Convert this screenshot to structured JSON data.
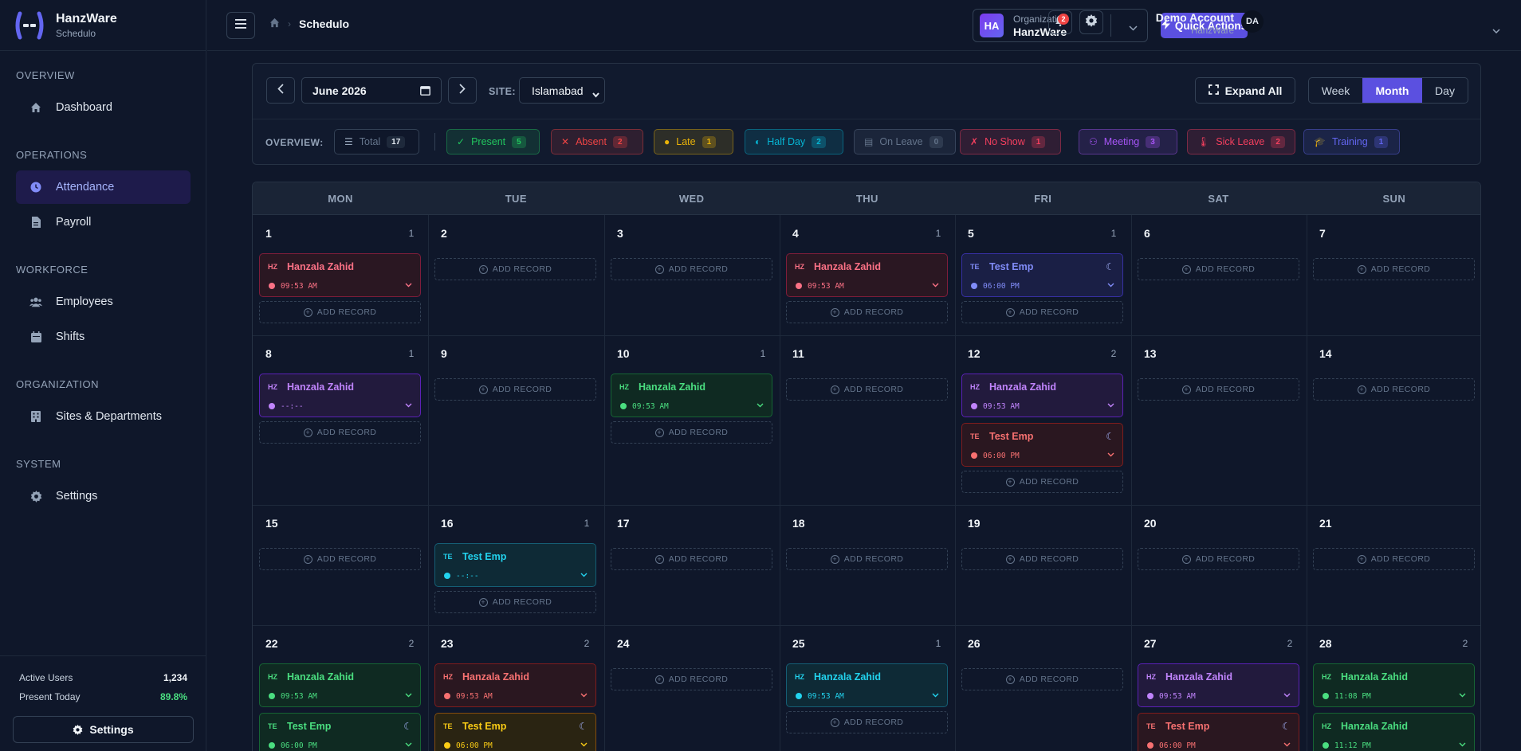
{
  "brand": {
    "name": "HanzWare",
    "sub": "Schedulo"
  },
  "nav": {
    "overview": "OVERVIEW",
    "dashboard": "Dashboard",
    "operations": "OPERATIONS",
    "attendance": "Attendance",
    "payroll": "Payroll",
    "workforce": "WORKFORCE",
    "employees": "Employees",
    "shifts": "Shifts",
    "organization": "ORGANIZATION",
    "sites": "Sites & Departments",
    "system": "SYSTEM",
    "settings": "Settings"
  },
  "sidebar_footer": {
    "active_users_label": "Active Users",
    "active_users_value": "1,234",
    "present_today_label": "Present Today",
    "present_today_value": "89.8%",
    "settings_button": "Settings"
  },
  "topbar": {
    "breadcrumb_current": "Schedulo",
    "org_badge": "HA",
    "org_label": "Organization",
    "org_name": "HanzWare",
    "quick_actions": "Quick Actions",
    "notif_count": "2",
    "account_name": "Demo Account",
    "account_sub": "HanzWare",
    "avatar": "DA"
  },
  "toolbar": {
    "date": "June 2026",
    "site_label": "SITE:",
    "site_value": "Islamabad",
    "expand_all": "Expand All",
    "views": [
      "Week",
      "Month",
      "Day"
    ],
    "active_view": "Month"
  },
  "overview": {
    "label": "OVERVIEW:",
    "chips": [
      {
        "label": "Total",
        "count": "17",
        "color": "#94a3b8"
      },
      {
        "label": "Present",
        "count": "5",
        "color": "#22c55e"
      },
      {
        "label": "Absent",
        "count": "2",
        "color": "#ef4444"
      },
      {
        "label": "Late",
        "count": "1",
        "color": "#eab308"
      },
      {
        "label": "Half Day",
        "count": "2",
        "color": "#06b6d4"
      },
      {
        "label": "On Leave",
        "count": "0",
        "color": "#64748b"
      },
      {
        "label": "No Show",
        "count": "1",
        "color": "#f43f5e"
      },
      {
        "label": "Meeting",
        "count": "3",
        "color": "#a855f7"
      },
      {
        "label": "Sick Leave",
        "count": "2",
        "color": "#f43f5e"
      },
      {
        "label": "Training",
        "count": "1",
        "color": "#6366f1"
      }
    ]
  },
  "calendar": {
    "days": [
      "MON",
      "TUE",
      "WED",
      "THU",
      "FRI",
      "SAT",
      "SUN"
    ],
    "add_label": "ADD RECORD",
    "weeks": [
      [
        {
          "d": "1",
          "count": "1",
          "records": [
            {
              "ini": "HZ",
              "name": "Hanzala Zahid",
              "time": "09:53 AM",
              "status": "sick"
            }
          ]
        },
        {
          "d": "2",
          "records": []
        },
        {
          "d": "3",
          "records": []
        },
        {
          "d": "4",
          "count": "1",
          "records": [
            {
              "ini": "HZ",
              "name": "Hanzala Zahid",
              "time": "09:53 AM",
              "status": "sick"
            }
          ]
        },
        {
          "d": "5",
          "count": "1",
          "records": [
            {
              "ini": "TE",
              "name": "Test Emp",
              "time": "06:00 PM",
              "status": "training",
              "night": true
            }
          ]
        },
        {
          "d": "6",
          "records": []
        },
        {
          "d": "7",
          "records": []
        }
      ],
      [
        {
          "d": "8",
          "count": "1",
          "records": [
            {
              "ini": "HZ",
              "name": "Hanzala Zahid",
              "time": "--:--",
              "status": "meeting"
            }
          ]
        },
        {
          "d": "9",
          "records": []
        },
        {
          "d": "10",
          "count": "1",
          "records": [
            {
              "ini": "HZ",
              "name": "Hanzala Zahid",
              "time": "09:53 AM",
              "status": "present"
            }
          ]
        },
        {
          "d": "11",
          "records": []
        },
        {
          "d": "12",
          "count": "2",
          "records": [
            {
              "ini": "HZ",
              "name": "Hanzala Zahid",
              "time": "09:53 AM",
              "status": "meeting"
            },
            {
              "ini": "TE",
              "name": "Test Emp",
              "time": "06:00 PM",
              "status": "absent",
              "night": true
            }
          ]
        },
        {
          "d": "13",
          "records": []
        },
        {
          "d": "14",
          "records": []
        }
      ],
      [
        {
          "d": "15",
          "records": []
        },
        {
          "d": "16",
          "count": "1",
          "records": [
            {
              "ini": "TE",
              "name": "Test Emp",
              "time": "--:--",
              "status": "halfday"
            }
          ]
        },
        {
          "d": "17",
          "records": []
        },
        {
          "d": "18",
          "records": []
        },
        {
          "d": "19",
          "records": []
        },
        {
          "d": "20",
          "records": []
        },
        {
          "d": "21",
          "records": []
        }
      ],
      [
        {
          "d": "22",
          "count": "2",
          "records": [
            {
              "ini": "HZ",
              "name": "Hanzala Zahid",
              "time": "09:53 AM",
              "status": "present"
            },
            {
              "ini": "TE",
              "name": "Test Emp",
              "time": "06:00 PM",
              "status": "present",
              "night": true
            }
          ]
        },
        {
          "d": "23",
          "count": "2",
          "records": [
            {
              "ini": "HZ",
              "name": "Hanzala Zahid",
              "time": "09:53 AM",
              "status": "absent"
            },
            {
              "ini": "TE",
              "name": "Test Emp",
              "time": "06:00 PM",
              "status": "late",
              "night": true
            }
          ]
        },
        {
          "d": "24",
          "records": []
        },
        {
          "d": "25",
          "count": "1",
          "records": [
            {
              "ini": "HZ",
              "name": "Hanzala Zahid",
              "time": "09:53 AM",
              "status": "halfday"
            }
          ]
        },
        {
          "d": "26",
          "records": []
        },
        {
          "d": "27",
          "count": "2",
          "records": [
            {
              "ini": "HZ",
              "name": "Hanzala Zahid",
              "time": "09:53 AM",
              "status": "meeting"
            },
            {
              "ini": "TE",
              "name": "Test Emp",
              "time": "06:00 PM",
              "status": "absent",
              "night": true
            }
          ]
        },
        {
          "d": "28",
          "count": "2",
          "records": [
            {
              "ini": "HZ",
              "name": "Hanzala Zahid",
              "time": "11:08 PM",
              "status": "present"
            },
            {
              "ini": "HZ",
              "name": "Hanzala Zahid",
              "time": "11:12 PM",
              "status": "present"
            }
          ]
        }
      ]
    ]
  },
  "status_colors": {
    "present": {
      "bg": "#0f2a22",
      "border": "#166534",
      "text": "#4ade80"
    },
    "absent": {
      "bg": "#2a1720",
      "border": "#7f1d1d",
      "text": "#f87171"
    },
    "sick": {
      "bg": "#2a1722",
      "border": "#7f1d3a",
      "text": "#fb7185"
    },
    "meeting": {
      "bg": "#221a3d",
      "border": "#5b21b6",
      "text": "#c084fc"
    },
    "training": {
      "bg": "#1a1f45",
      "border": "#3730a3",
      "text": "#818cf8"
    },
    "halfday": {
      "bg": "#0e2a36",
      "border": "#155e75",
      "text": "#22d3ee"
    },
    "late": {
      "bg": "#2a2412",
      "border": "#854d0e",
      "text": "#facc15"
    }
  }
}
